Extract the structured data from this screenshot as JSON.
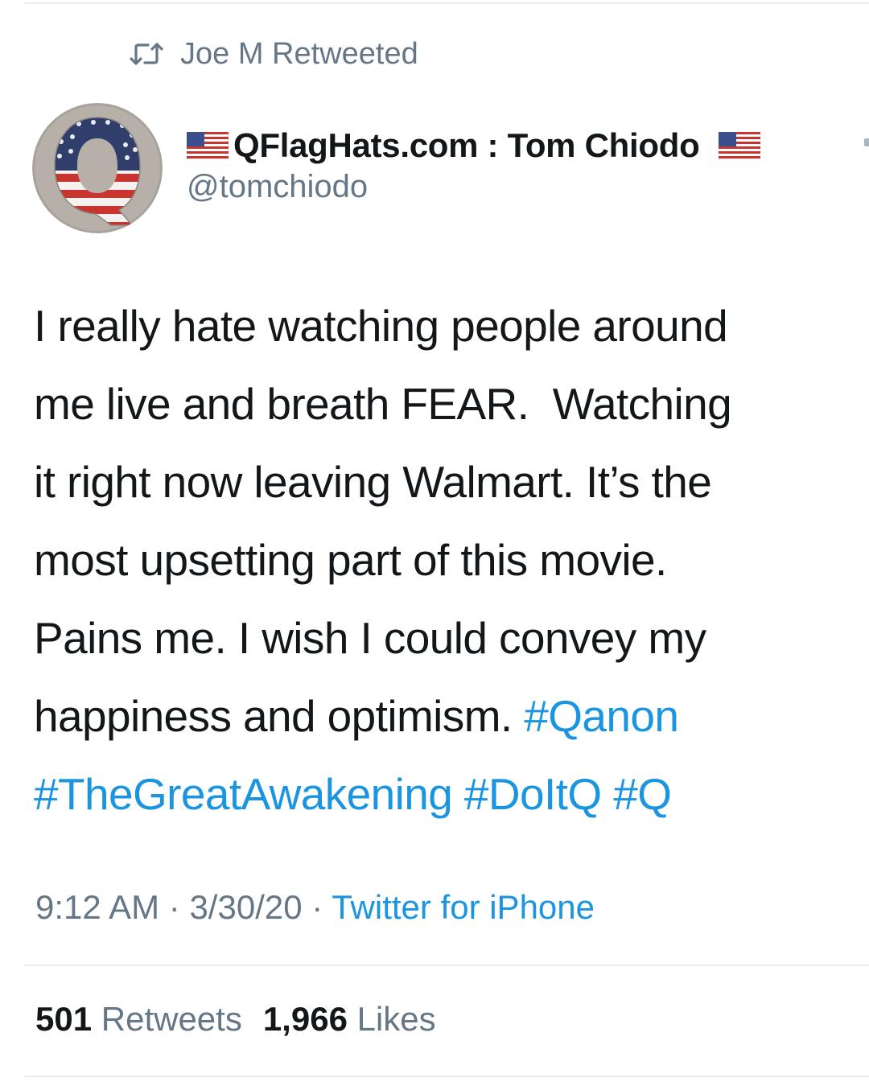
{
  "retweet_context": {
    "icon": "retweet-icon",
    "label": "Joe M Retweeted"
  },
  "author": {
    "avatar_icon": "q-flag-avatar",
    "display_name": "QFlagHats.com : Tom Chiodo",
    "flag_icon": "us-flag-emoji",
    "handle": "@tomchiodo"
  },
  "tweet": {
    "lines": [
      "I really hate watching people around",
      "me live and breath FEAR.  Watching",
      "it right now leaving Walmart. It’s the",
      "most upsetting part of this movie.",
      "Pains me. I wish I could convey my",
      "happiness and optimism. "
    ],
    "hashtags": [
      "#Qanon",
      "#TheGreatAwakening",
      "#DoItQ",
      "#Q"
    ]
  },
  "meta": {
    "time": "9:12 AM",
    "separator": "·",
    "date": "3/30/20",
    "source": "Twitter for iPhone"
  },
  "stats": {
    "retweets_count": "501",
    "retweets_label": "Retweets",
    "likes_count": "1,966",
    "likes_label": "Likes"
  },
  "colors": {
    "text": "#14171a",
    "secondary": "#657786",
    "link": "#1b95e0",
    "divider": "#e6ecf0"
  }
}
